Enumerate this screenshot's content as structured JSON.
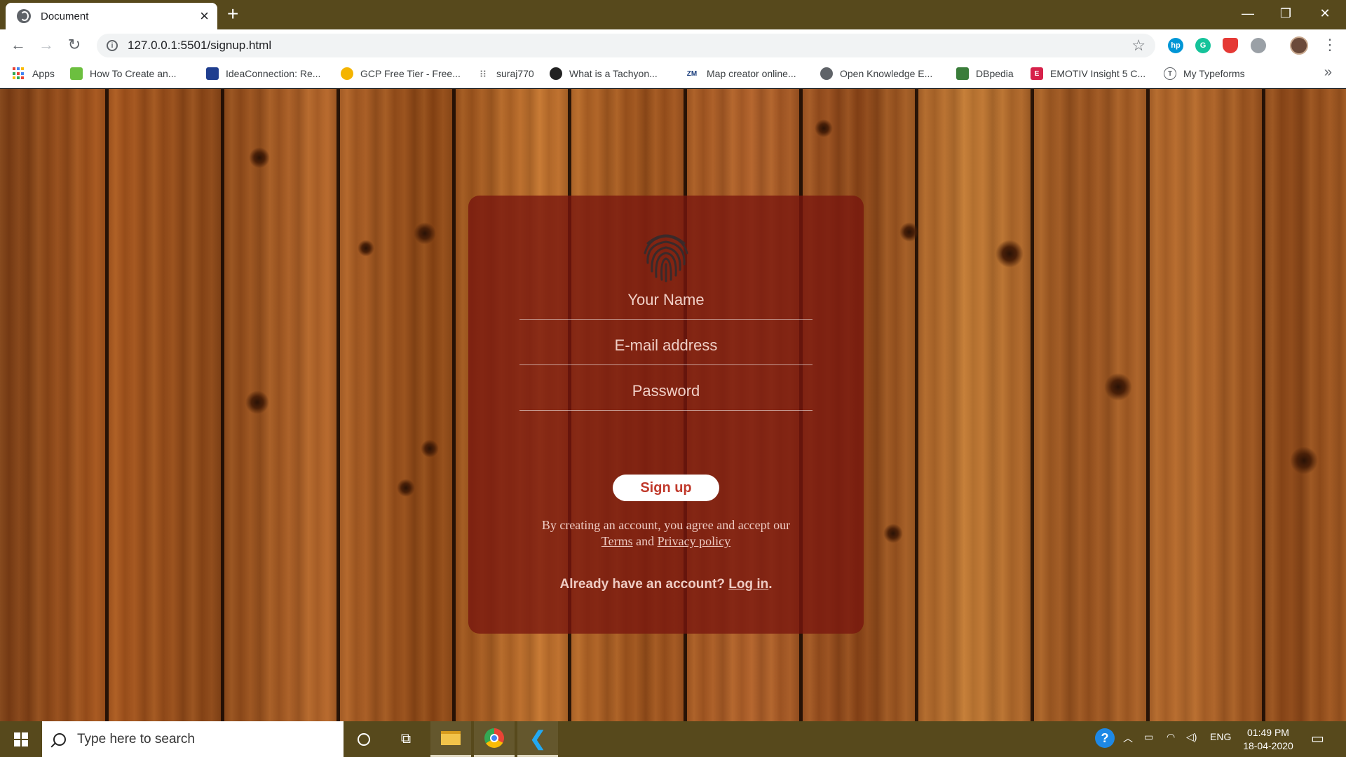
{
  "browser": {
    "tab_title": "Document",
    "new_tab": "+",
    "url": "127.0.0.1:5501/signup.html",
    "window_controls": {
      "minimize": "—",
      "restore": "❐",
      "close": "✕"
    },
    "bookmarks": [
      {
        "label": "Apps",
        "icon": "apps-grid-icon"
      },
      {
        "label": "How To Create an...",
        "icon": "green-icon",
        "icon_color": "#6cbf3f"
      },
      {
        "label": "IdeaConnection: Re...",
        "icon": "idea-icon",
        "icon_color": "#1f3e8f"
      },
      {
        "label": "GCP Free Tier - Free...",
        "icon": "gcp-icon",
        "icon_color": "#f4b400"
      },
      {
        "label": "suraj770",
        "icon": "dots-icon",
        "icon_color": "#888888"
      },
      {
        "label": "What is a Tachyon...",
        "icon": "tachyon-icon",
        "icon_color": "#222222"
      },
      {
        "label": "Map creator online...",
        "icon": "zm-icon",
        "icon_text": "ZM",
        "icon_color": "#1a3d7c"
      },
      {
        "label": "Open Knowledge E...",
        "icon": "globe-icon",
        "icon_color": "#5f6368"
      },
      {
        "label": "DBpedia",
        "icon": "dbpedia-icon",
        "icon_color": "#3a7d3a"
      },
      {
        "label": "EMOTIV Insight 5 C...",
        "icon": "emotiv-icon",
        "icon_text": "E",
        "icon_color": "#d6214a"
      },
      {
        "label": "My Typeforms",
        "icon": "typeform-icon",
        "icon_text": "T",
        "icon_color": "#5f6368"
      }
    ],
    "bookmarks_more": "»"
  },
  "form": {
    "name_placeholder": "Your Name",
    "email_placeholder": "E-mail address",
    "password_placeholder": "Password",
    "signup_label": "Sign up",
    "terms_prefix": "By creating an account, you agree and accept our",
    "terms_link": "Terms",
    "terms_and": "and",
    "privacy_link": "Privacy policy",
    "already_text": "Already have an account?",
    "login_link": "Log in",
    "login_suffix": "."
  },
  "taskbar": {
    "search_placeholder": "Type here to search",
    "tray_language": "ENG",
    "time": "01:49 PM",
    "date": "18-04-2020"
  },
  "colors": {
    "chrome_bar": "#57491c",
    "card_bg": "rgba(120,22,14,0.78)",
    "signup_text": "#c0392b"
  }
}
